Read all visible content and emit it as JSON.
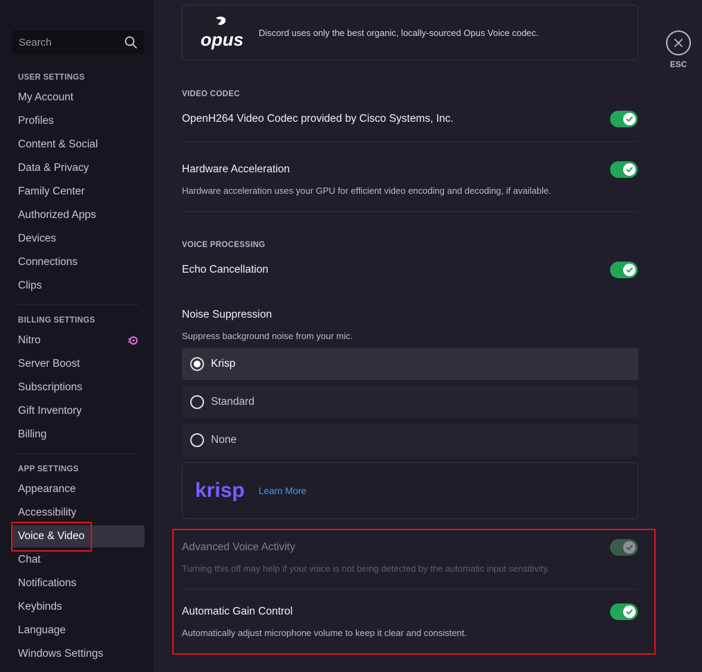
{
  "sidebar": {
    "search_placeholder": "Search",
    "user_settings_header": "USER SETTINGS",
    "user_items": [
      "My Account",
      "Profiles",
      "Content & Social",
      "Data & Privacy",
      "Family Center",
      "Authorized Apps",
      "Devices",
      "Connections",
      "Clips"
    ],
    "billing_settings_header": "BILLING SETTINGS",
    "billing_items": [
      "Nitro",
      "Server Boost",
      "Subscriptions",
      "Gift Inventory",
      "Billing"
    ],
    "app_settings_header": "APP SETTINGS",
    "app_items": [
      "Appearance",
      "Accessibility",
      "Voice & Video",
      "Chat",
      "Notifications",
      "Keybinds",
      "Language",
      "Windows Settings"
    ],
    "active_item": "Voice & Video"
  },
  "main": {
    "opus": {
      "logo_text": "opus",
      "description": "Discord uses only the best organic, locally-sourced Opus Voice codec."
    },
    "video_codec": {
      "label": "VIDEO CODEC",
      "openh264": {
        "title": "OpenH264 Video Codec provided by Cisco Systems, Inc.",
        "enabled": true
      },
      "hardware_acceleration": {
        "title": "Hardware Acceleration",
        "description": "Hardware acceleration uses your GPU for efficient video encoding and decoding, if available.",
        "enabled": true
      }
    },
    "voice_processing": {
      "label": "VOICE PROCESSING",
      "echo_cancellation": {
        "title": "Echo Cancellation",
        "enabled": true
      },
      "noise_suppression": {
        "title": "Noise Suppression",
        "description": "Suppress background noise from your mic.",
        "options": [
          "Krisp",
          "Standard",
          "None"
        ],
        "selected": "Krisp"
      },
      "krisp": {
        "logo_text": "krisp",
        "learn_more": "Learn More"
      },
      "advanced_voice_activity": {
        "title": "Advanced Voice Activity",
        "description": "Turning this off may help if your voice is not being detected by the automatic input sensitivity.",
        "enabled": true,
        "disabled": true
      },
      "automatic_gain_control": {
        "title": "Automatic Gain Control",
        "description": "Automatically adjust microphone volume to keep it clear and consistent.",
        "enabled": true
      }
    },
    "close": {
      "label": "ESC"
    }
  },
  "colors": {
    "toggle_on": "#23a55a",
    "link": "#3f9ff6",
    "highlight": "#e0141e",
    "krisp_brand": "#7b5cff",
    "nitro_icon": "#e86ce3"
  }
}
